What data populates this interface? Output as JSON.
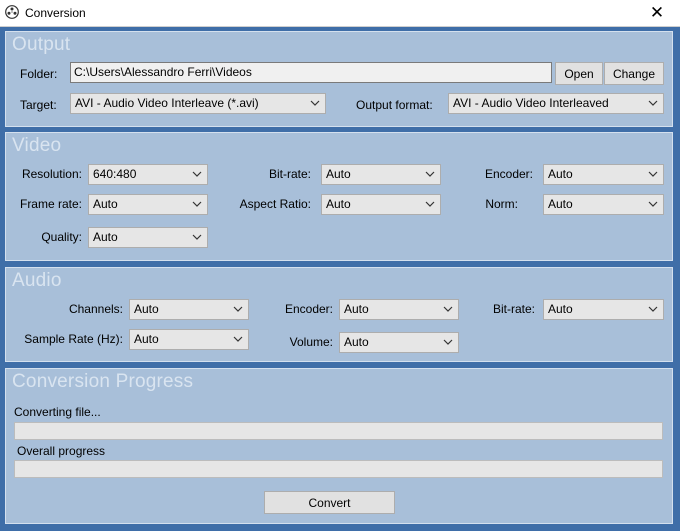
{
  "window": {
    "title": "Conversion",
    "close_glyph": "✕",
    "icon": "app-icon"
  },
  "output": {
    "section_title": "Output",
    "folder_label": "Folder:",
    "folder_value": "C:\\Users\\Alessandro Ferri\\Videos",
    "open_label": "Open",
    "change_label": "Change",
    "target_label": "Target:",
    "target_value": "AVI - Audio Video Interleave (*.avi)",
    "format_label": "Output format:",
    "format_value": "AVI - Audio Video Interleaved"
  },
  "video": {
    "section_title": "Video",
    "resolution_label": "Resolution:",
    "resolution_value": "640:480",
    "framerate_label": "Frame rate:",
    "framerate_value": "Auto",
    "quality_label": "Quality:",
    "quality_value": "Auto",
    "bitrate_label": "Bit-rate:",
    "bitrate_value": "Auto",
    "aspect_label": "Aspect Ratio:",
    "aspect_value": "Auto",
    "encoder_label": "Encoder:",
    "encoder_value": "Auto",
    "norm_label": "Norm:",
    "norm_value": "Auto"
  },
  "audio": {
    "section_title": "Audio",
    "channels_label": "Channels:",
    "channels_value": "Auto",
    "samplerate_label": "Sample Rate (Hz):",
    "samplerate_value": "Auto",
    "encoder_label": "Encoder:",
    "encoder_value": "Auto",
    "volume_label": "Volume:",
    "volume_value": "Auto",
    "bitrate_label": "Bit-rate:",
    "bitrate_value": "Auto"
  },
  "progress": {
    "section_title": "Conversion Progress",
    "file_label": "Converting file...",
    "file_progress": 0,
    "overall_label": "Overall progress",
    "overall_progress": 0,
    "convert_label": "Convert"
  },
  "colors": {
    "frame": "#3f6ea8",
    "panel": "#a8bfd9",
    "panel_title": "#d9e4f0"
  }
}
